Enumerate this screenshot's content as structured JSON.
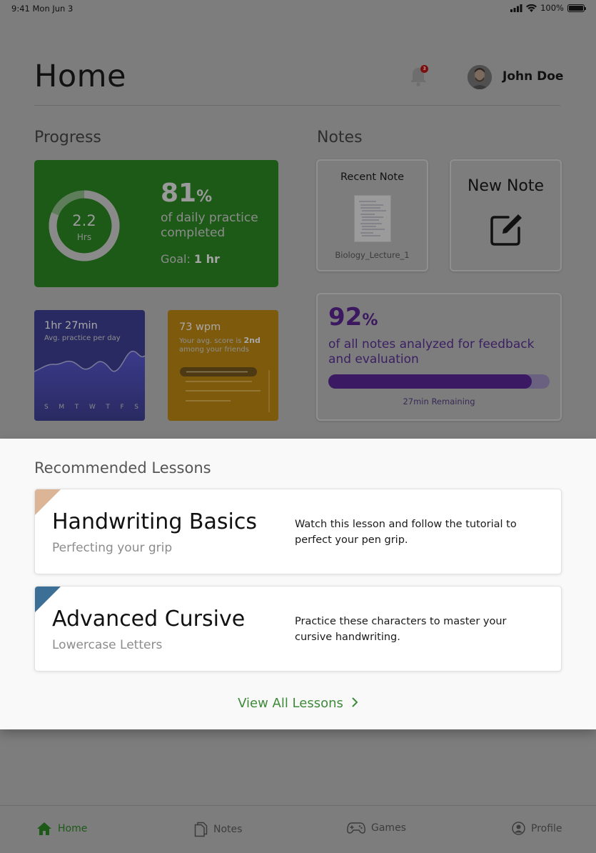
{
  "status_bar": {
    "time": "9:41 Mon Jun 3",
    "battery": "100%"
  },
  "header": {
    "title": "Home",
    "notification_count": "3",
    "user_name": "John Doe"
  },
  "progress": {
    "section_title": "Progress",
    "hours_value": "2.2",
    "hours_unit": "Hrs",
    "percent": "81",
    "percent_sign": "%",
    "daily_text": "of daily practice completed",
    "goal_label": "Goal:",
    "goal_value": "1 hr",
    "ring_fraction": 0.81,
    "practice_card": {
      "title": "1hr 27min",
      "subtitle": "Avg. practice per day",
      "days": [
        "S",
        "M",
        "T",
        "W",
        "T",
        "F",
        "S"
      ]
    },
    "wpm_card": {
      "title": "73 wpm",
      "subtitle_pre": "Your avg. score is ",
      "subtitle_rank": "2nd",
      "subtitle_post": " among your friends"
    }
  },
  "notes": {
    "section_title": "Notes",
    "recent_label": "Recent Note",
    "recent_file": "Biology_Lecture_1",
    "new_label": "New Note",
    "analyzed_percent": "92",
    "percent_sign": "%",
    "analyzed_text": "of all notes analyzed for feedback and evaluation",
    "analyzed_fraction": 0.92,
    "remaining": "27min Remaining"
  },
  "recommended": {
    "title": "Recommended Lessons",
    "lessons": [
      {
        "title": "Handwriting Basics",
        "subtitle": "Perfecting your grip",
        "description": "Watch this lesson and follow the tutorial to perfect your pen grip.",
        "accent": "#dcb496"
      },
      {
        "title": "Advanced Cursive",
        "subtitle": "Lowercase Letters",
        "description": "Practice these characters to master your cursive handwriting.",
        "accent": "#3b6f95"
      }
    ],
    "view_all": "View All Lessons"
  },
  "tabs": [
    {
      "label": "Home",
      "icon": "home-icon",
      "active": true
    },
    {
      "label": "Notes",
      "icon": "notes-icon",
      "active": false
    },
    {
      "label": "Games",
      "icon": "gamepad-icon",
      "active": false
    },
    {
      "label": "Profile",
      "icon": "profile-icon",
      "active": false
    }
  ],
  "colors": {
    "brand_green": "#3f8a3a",
    "purple": "#3b1a63"
  }
}
